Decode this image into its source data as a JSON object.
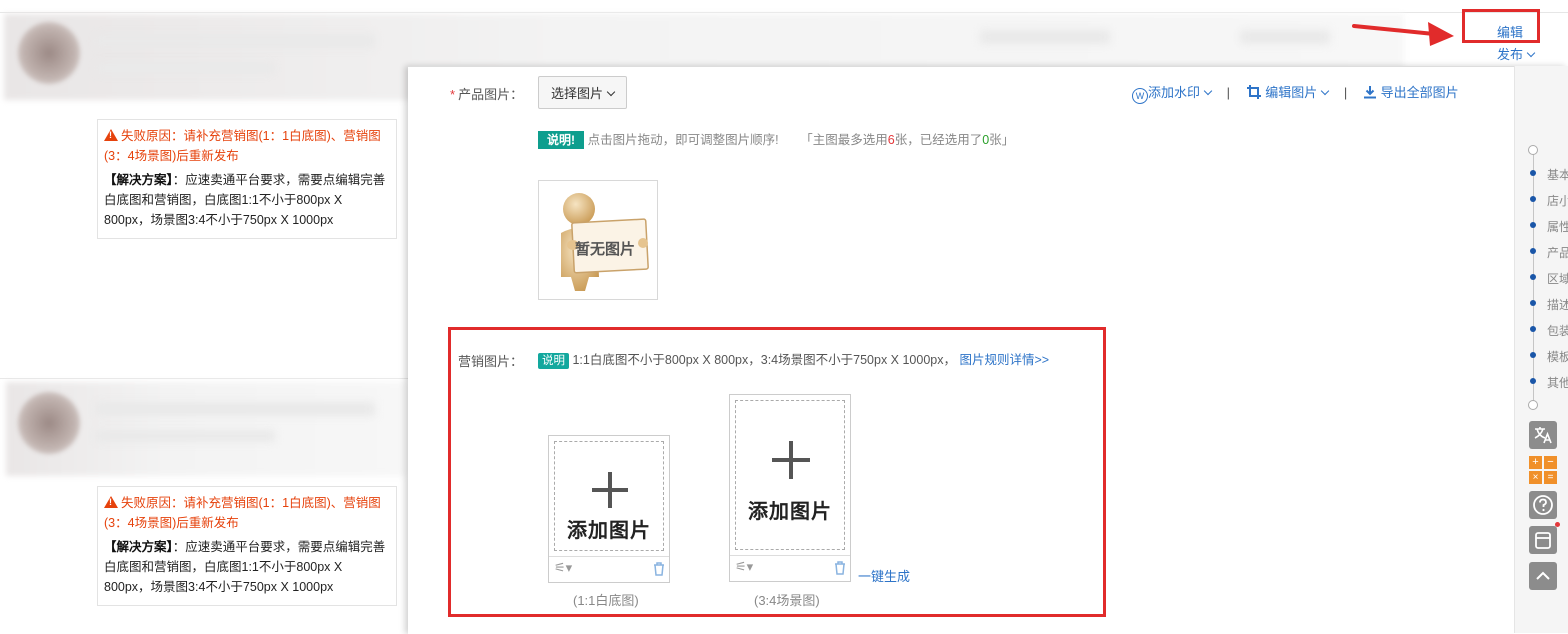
{
  "header": {
    "edit_label": "编辑",
    "publish_label": "发布"
  },
  "failures": [
    {
      "reason": "失败原因：请补充营销图(1：1白底图)、营销图(3：4场景图)后重新发布",
      "solution_label": "【解决方案】",
      "solution": "：应速卖通平台要求，需要点编辑完善白底图和营销图，白底图1:1不小于800px X 800px，场景图3:4不小于750px X 1000px"
    },
    {
      "reason": "失败原因：请补充营销图(1：1白底图)、营销图(3：4场景图)后重新发布",
      "solution_label": "【解决方案】",
      "solution": "：应速卖通平台要求，需要点编辑完善白底图和营销图，白底图1:1不小于800px X 800px，场景图3:4不小于750px X 1000px"
    }
  ],
  "product_images": {
    "required_mark": "*",
    "label": "产品图片：",
    "select_button": "选择图片",
    "toolbar": {
      "watermark": "添加水印",
      "edit_image": "编辑图片",
      "export_all": "导出全部图片",
      "separator": "|"
    },
    "tip_badge": "说明!",
    "tip_text": "点击图片拖动，即可调整图片顺序!",
    "count_prefix": "「主图最多选用",
    "max_count": "6",
    "count_mid": "张，已经选用了",
    "used_count": "0",
    "count_suffix": "张」",
    "placeholder_text": "暂无图片"
  },
  "marketing_images": {
    "label": "营销图片：",
    "badge": "说明",
    "description": "1:1白底图不小于800px X 800px，3:4场景图不小于750px X 1000px，",
    "rule_link": "图片规则详情>>",
    "uploaders": [
      {
        "add_text": "添加图片",
        "caption": "(1:1白底图)"
      },
      {
        "add_text": "添加图片",
        "caption": "(3:4场景图)"
      }
    ],
    "one_click": "一键生成"
  },
  "right_nav": {
    "items": [
      "基本",
      "店小",
      "属性",
      "产品",
      "区域",
      "描述",
      "包装",
      "模板",
      "其他"
    ],
    "tools": [
      "translate-icon",
      "calculator-icon",
      "help-icon",
      "clipboard-icon",
      "back-to-top-icon"
    ]
  },
  "colors": {
    "accent": "#2e74c8",
    "error": "#e6420c",
    "highlight_box": "#e12b2b",
    "badge": "#0e9e8e"
  }
}
